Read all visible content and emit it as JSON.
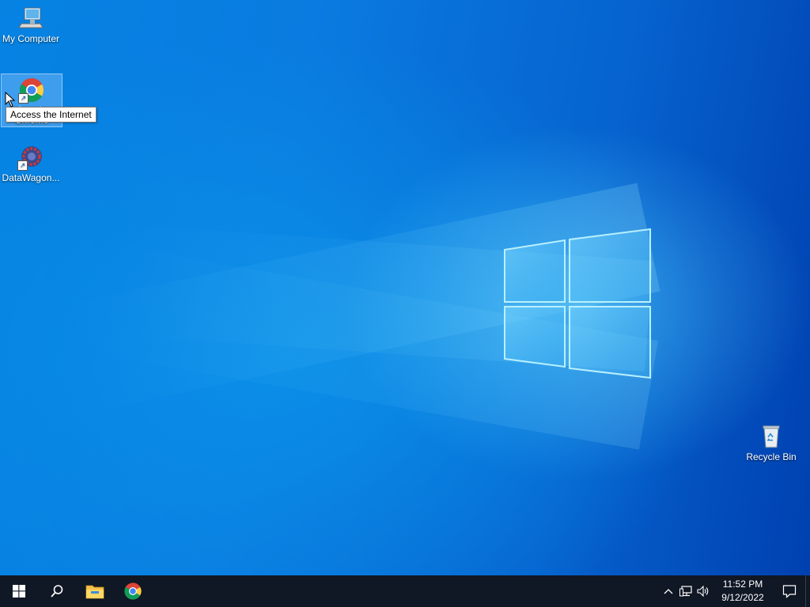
{
  "desktop": {
    "icons": [
      {
        "label": "My Computer",
        "icon": "computer-icon"
      },
      {
        "label": "Google Chrome",
        "icon": "chrome-icon",
        "selected": true
      },
      {
        "label": "DataWagon...",
        "icon": "datawagon-icon"
      },
      {
        "label": "Recycle Bin",
        "icon": "recycle-bin-icon"
      }
    ],
    "tooltip": "Access the Internet"
  },
  "taskbar": {
    "start": "start-icon",
    "search": "search-icon",
    "pinned": [
      {
        "name": "File Explorer",
        "icon": "folder-icon"
      },
      {
        "name": "Google Chrome",
        "icon": "chrome-icon"
      }
    ],
    "tray": {
      "time": "11:52 PM",
      "date": "9/12/2022"
    }
  },
  "colors": {
    "taskbar_bg": "#101725",
    "desktop_blue": "#0a7be0",
    "logo_glow": "#8fe3ff"
  }
}
